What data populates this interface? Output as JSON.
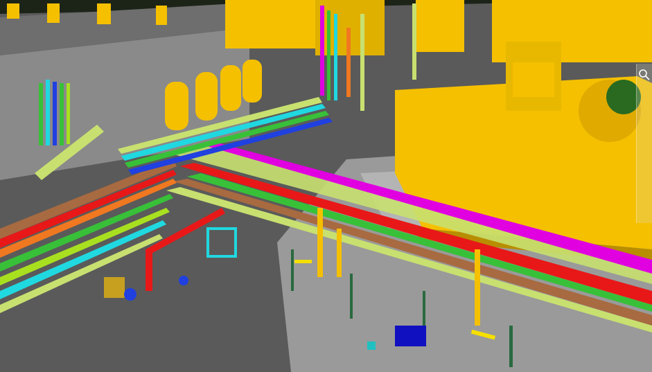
{
  "app": {
    "title": ""
  },
  "viewport": {
    "description_label": ""
  },
  "toolbar": {
    "search_icon": "search-icon"
  },
  "colors": {
    "ground": "#5a5a5a",
    "slab": "#8a8a8a",
    "equipment": "#f5c000",
    "equipment_shadow": "#b88d00",
    "pipe_magenta": "#e000e0",
    "pipe_brown": "#a86a40",
    "pipe_red": "#e81818",
    "pipe_green": "#38c038",
    "pipe_lime": "#a8e020",
    "pipe_cyan": "#20d8e0",
    "pipe_blue": "#2040e0",
    "pipe_orange": "#f07820",
    "steel_frame": "#c8e070",
    "background_dark": "#1c2418",
    "fence": "#90c090"
  }
}
